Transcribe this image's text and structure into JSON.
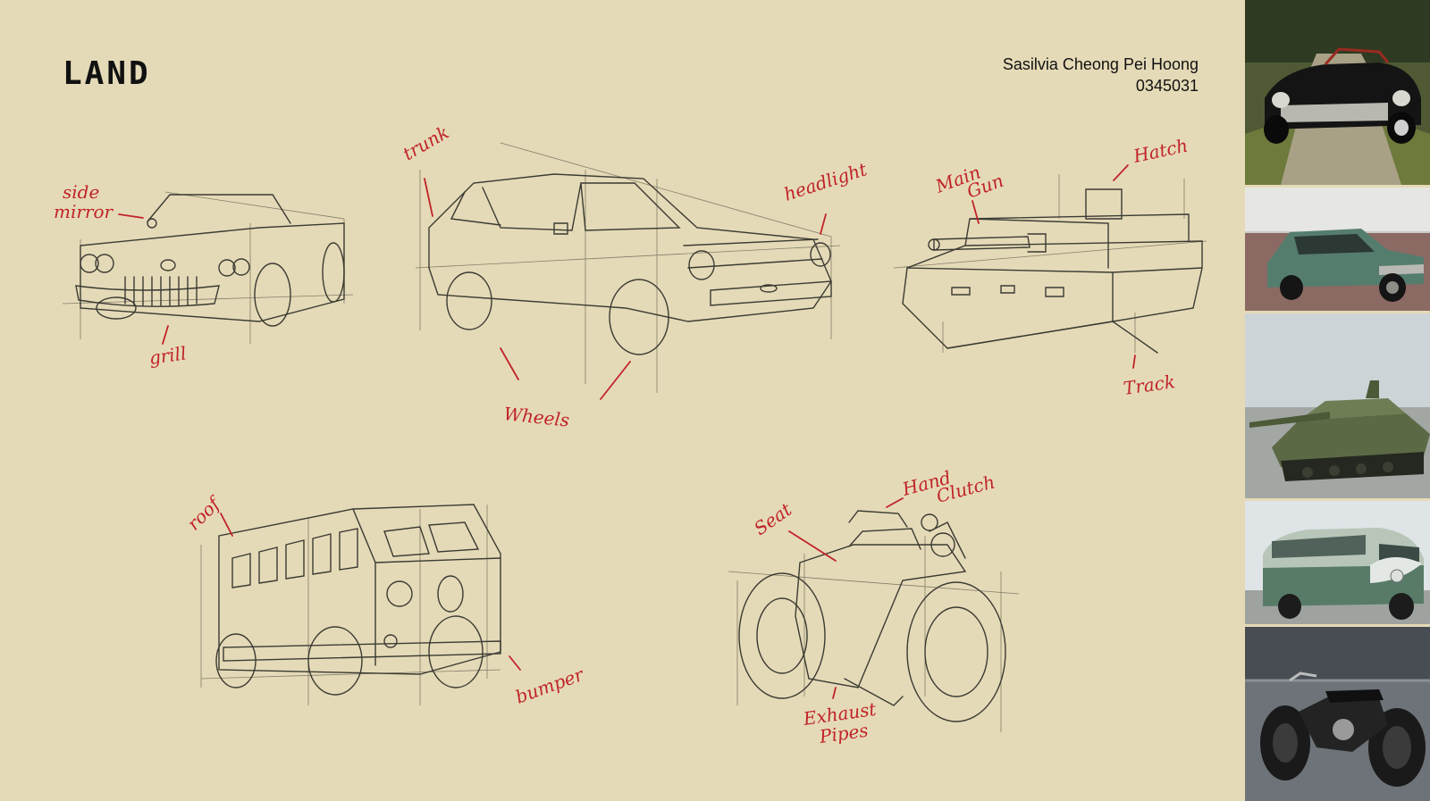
{
  "title": "LAND",
  "author": {
    "name": "Sasilvia Cheong Pei Hoong",
    "id": "0345031"
  },
  "labels": {
    "side_mirror": [
      "side",
      "mirror"
    ],
    "grill": "grill",
    "trunk": "trunk",
    "headlight": "headlight",
    "wheels": "Wheels",
    "main_gun": [
      "Main",
      "Gun"
    ],
    "hatch": "Hatch",
    "track": "Track",
    "roof": "roof",
    "bumper": "bumper",
    "seat": "Seat",
    "hand_clutch": [
      "Hand",
      "Clutch"
    ],
    "exhaust_pipes": [
      "Exhaust",
      "Pipes"
    ]
  },
  "colors": {
    "paper": "#e5dab7",
    "annotation": "#c0232a",
    "pencil": "#3b3b34"
  },
  "reference_photos": [
    "classic-convertible-photo",
    "hatchback-photo",
    "tank-photo",
    "vw-bus-photo",
    "motorcycle-photo"
  ]
}
